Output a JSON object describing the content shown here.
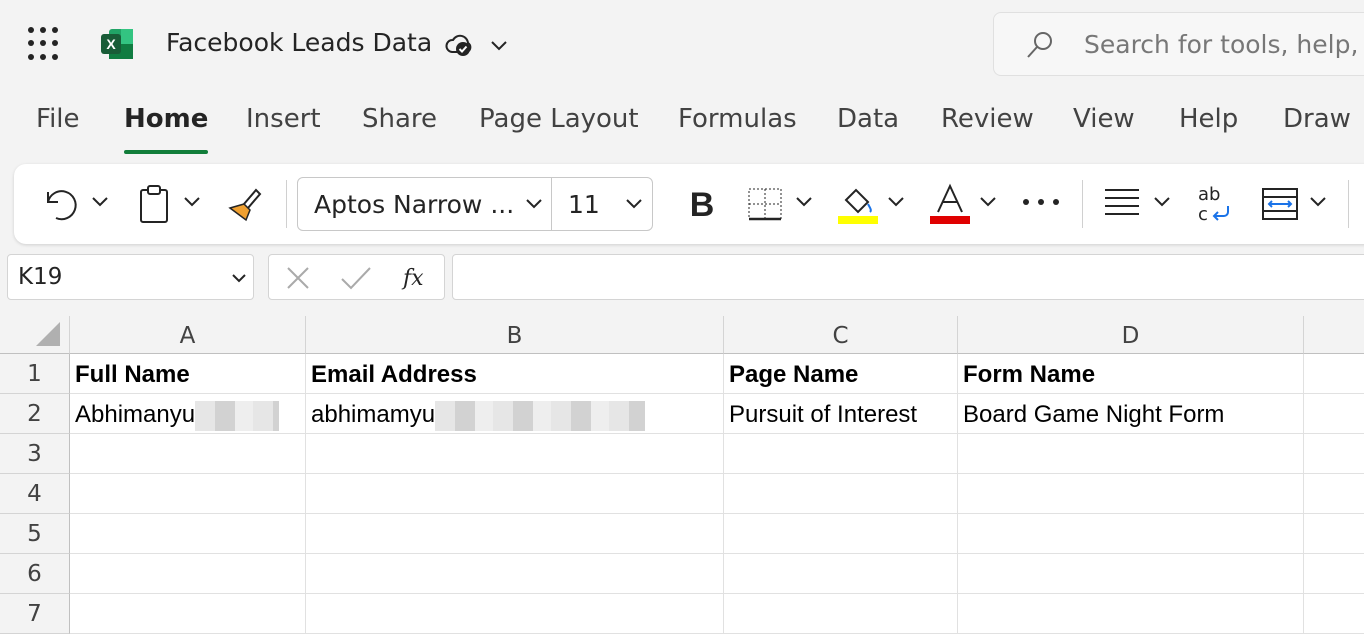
{
  "title_bar": {
    "doc_title": "Facebook Leads Data",
    "search_placeholder": "Search for tools, help, a"
  },
  "menu": {
    "tabs": [
      "File",
      "Home",
      "Insert",
      "Share",
      "Page Layout",
      "Formulas",
      "Data",
      "Review",
      "View",
      "Help",
      "Draw"
    ],
    "active_tab": "Home"
  },
  "ribbon": {
    "font_name": "Aptos Narrow ...",
    "font_size": "11",
    "fill_color": "#ffff00",
    "font_color": "#e00000"
  },
  "formula_bar": {
    "name_box": "K19",
    "formula": ""
  },
  "sheet": {
    "columns": [
      "A",
      "B",
      "C",
      "D"
    ],
    "rows": [
      "1",
      "2",
      "3",
      "4",
      "5",
      "6",
      "7"
    ],
    "header_row": [
      "Full Name",
      "Email Address",
      "Page Name",
      "Form Name"
    ],
    "data_row": [
      "Abhimanyu",
      "abhimamyu",
      "Pursuit of Interest",
      "Board Game Night Form"
    ]
  },
  "colors": {
    "accent": "#117d3a"
  }
}
